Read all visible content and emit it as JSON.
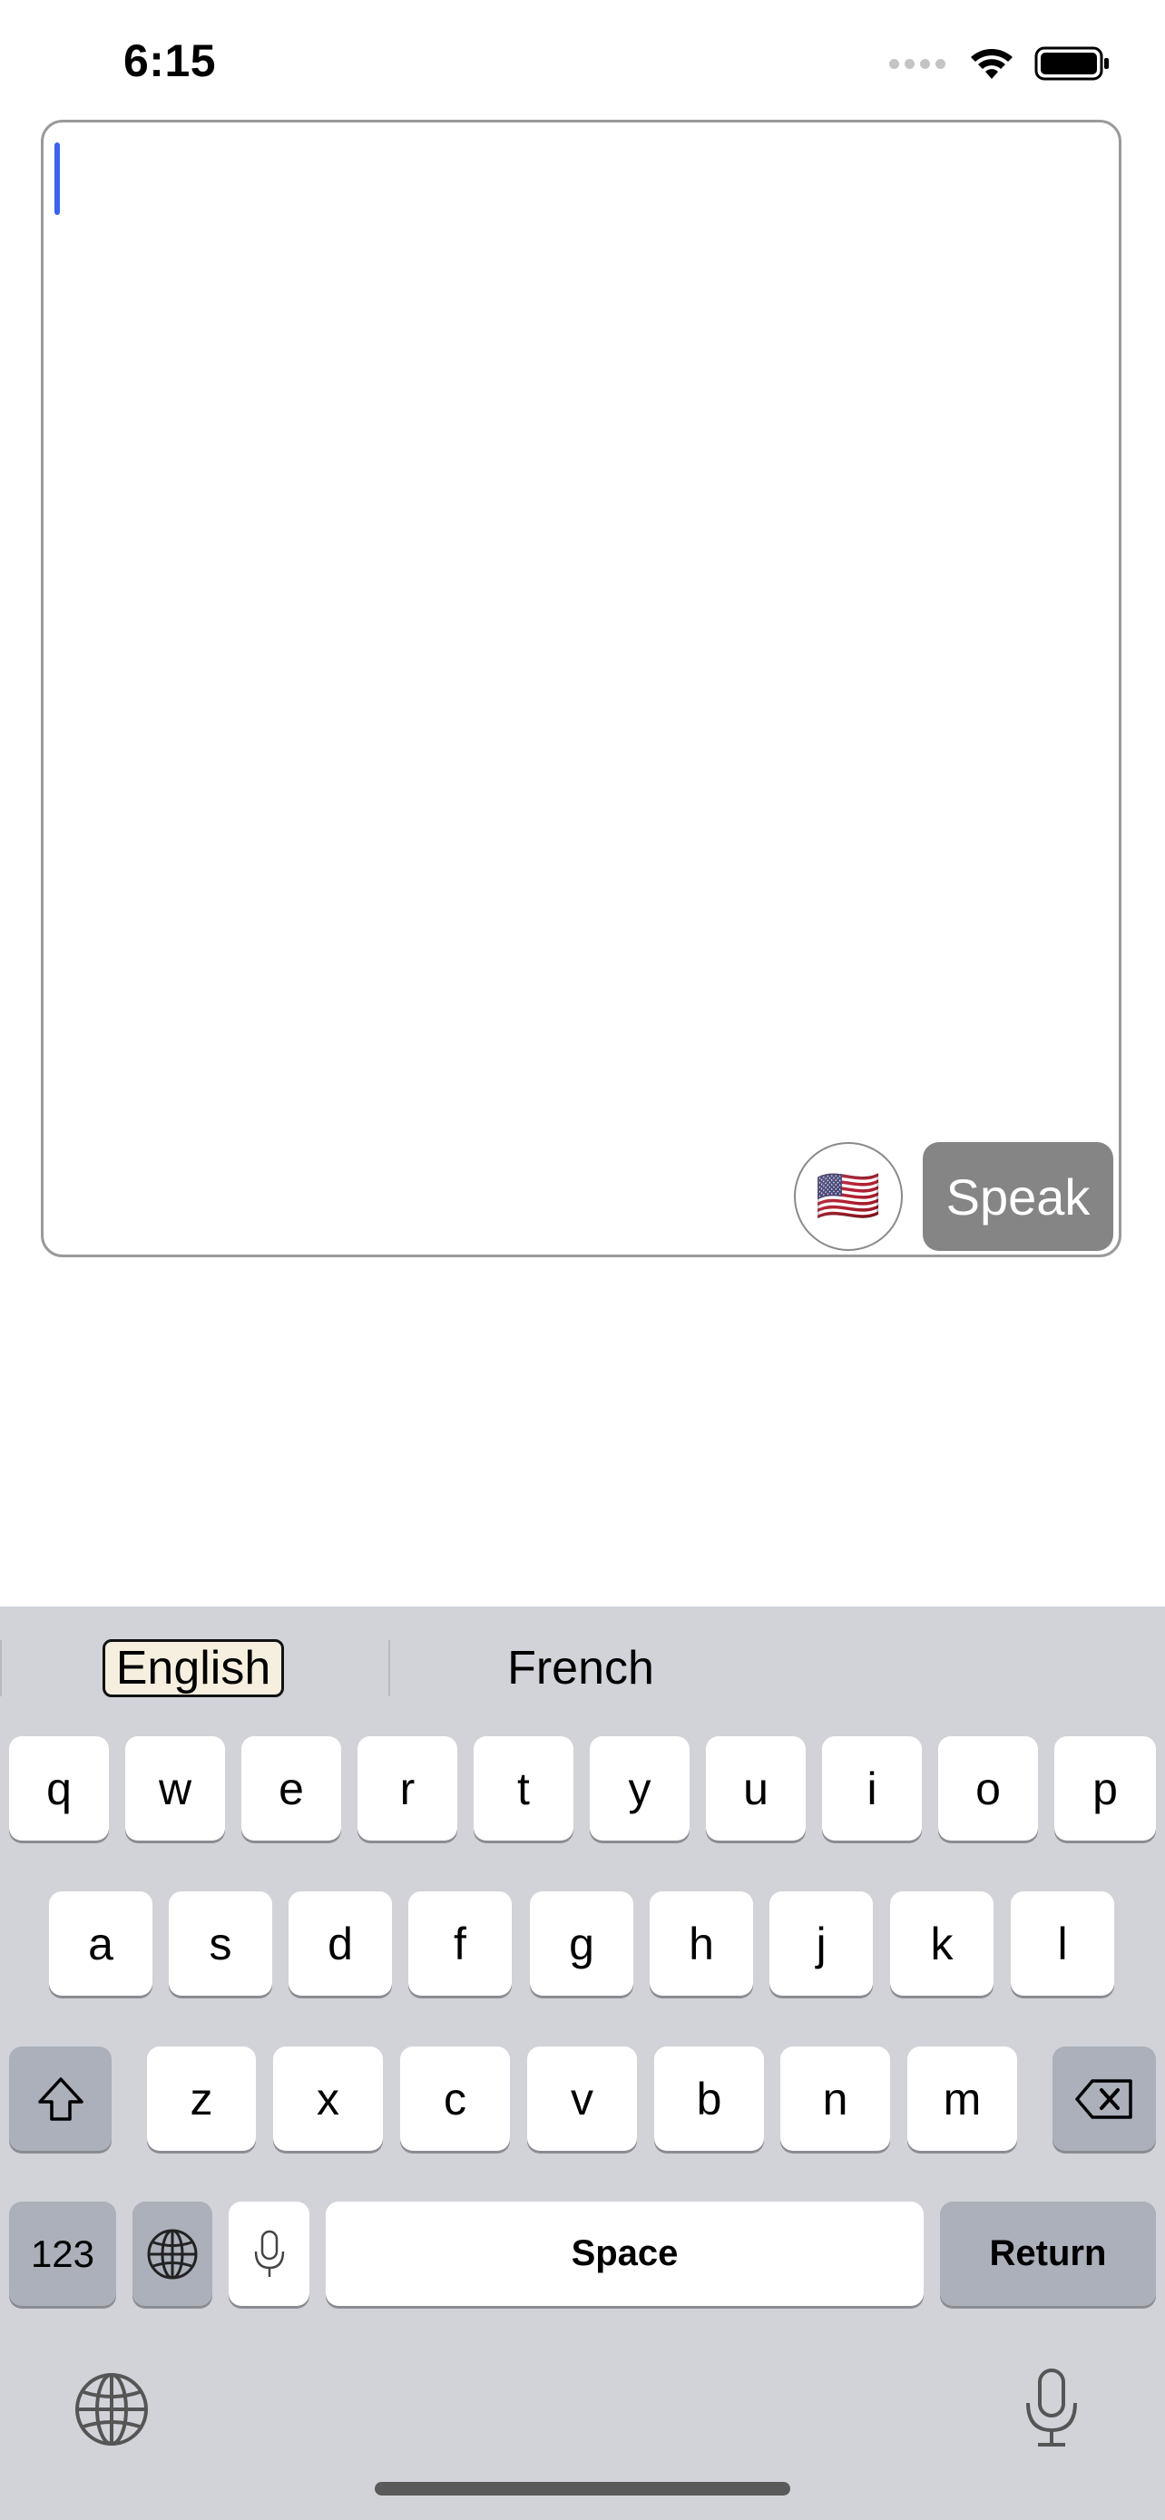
{
  "status_bar": {
    "time": "6:15",
    "icons": [
      "signal-dots-icon",
      "wifi-icon",
      "battery-icon"
    ]
  },
  "editor": {
    "text": "",
    "flag_emoji": "🇺🇸",
    "speak_label": "Speak"
  },
  "keyboard": {
    "suggestions": {
      "selected": "English",
      "other": "French"
    },
    "rows": [
      [
        "q",
        "w",
        "e",
        "r",
        "t",
        "y",
        "u",
        "i",
        "o",
        "p"
      ],
      [
        "a",
        "s",
        "d",
        "f",
        "g",
        "h",
        "j",
        "k",
        "l"
      ],
      [
        "z",
        "x",
        "c",
        "v",
        "b",
        "n",
        "m"
      ]
    ],
    "numbers_label": "123",
    "space_label": "Space",
    "return_label": "Return"
  },
  "colors": {
    "caret": "#3a64ec",
    "speak_button": "#858585",
    "keyboard_bg": "#d1d3d9",
    "suggestion_highlight": "#f6efdf"
  }
}
